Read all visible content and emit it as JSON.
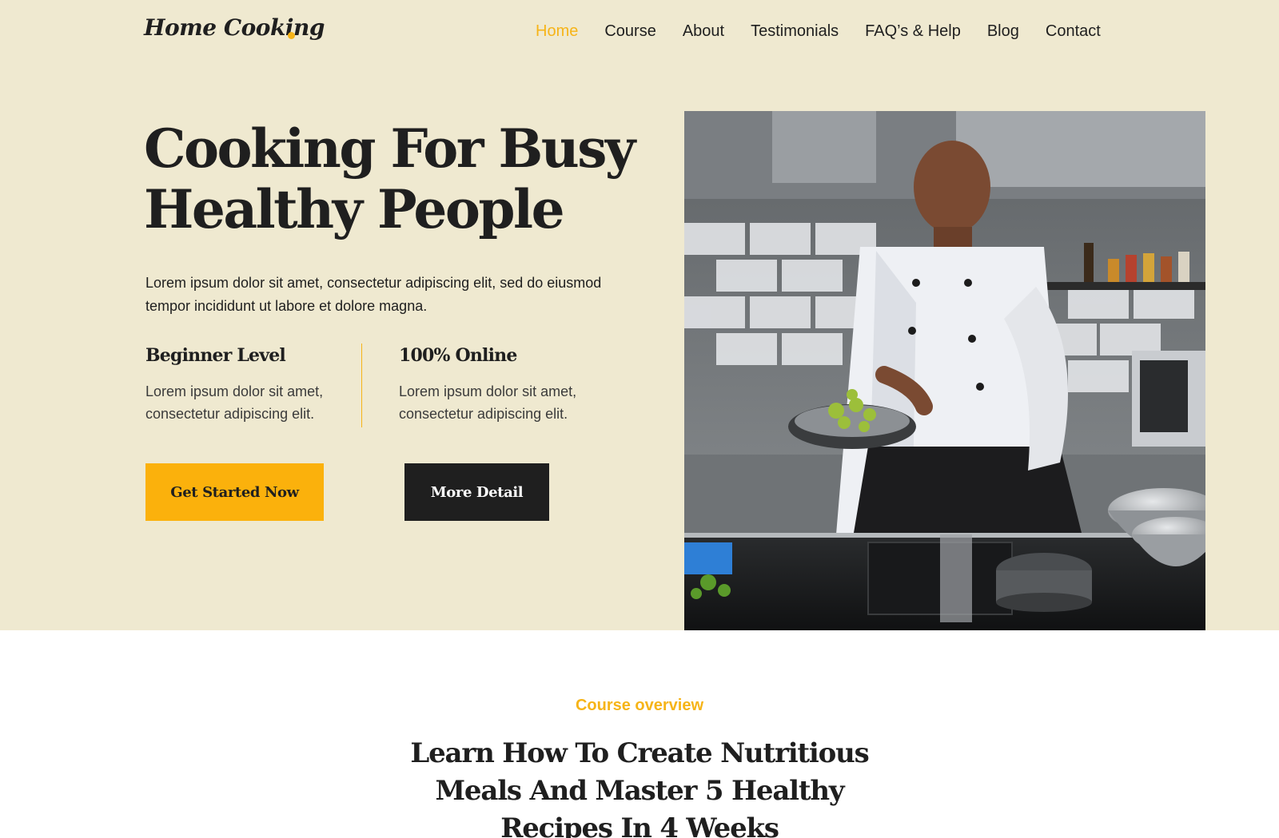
{
  "brand": {
    "name": "Home Cooking",
    "accent_color": "#f6b418",
    "hero_bg": "#efe9d0"
  },
  "nav": {
    "items": [
      {
        "label": "Home",
        "active": true
      },
      {
        "label": "Course"
      },
      {
        "label": "About"
      },
      {
        "label": "Testimonials"
      },
      {
        "label": "FAQ’s & Help"
      },
      {
        "label": "Blog"
      },
      {
        "label": "Contact"
      }
    ]
  },
  "hero": {
    "title": "Cooking For Busy Healthy People",
    "description": "Lorem ipsum dolor sit amet, consectetur adipiscing elit, sed do eiusmod tempor incididunt ut labore et dolore magna.",
    "features": [
      {
        "title": "Beginner Level",
        "text": "Lorem ipsum dolor sit amet, consectetur adipiscing elit."
      },
      {
        "title": "100% Online",
        "text": "Lorem ipsum dolor sit amet, consectetur adipiscing elit."
      }
    ],
    "primary_button": "Get Started Now",
    "secondary_button": "More Detail",
    "image_icon": "chef-cooking-photo"
  },
  "course_section": {
    "eyebrow": "Course overview",
    "title": "Learn How To Create Nutritious Meals And Master 5 Healthy Recipes In 4 Weeks"
  }
}
